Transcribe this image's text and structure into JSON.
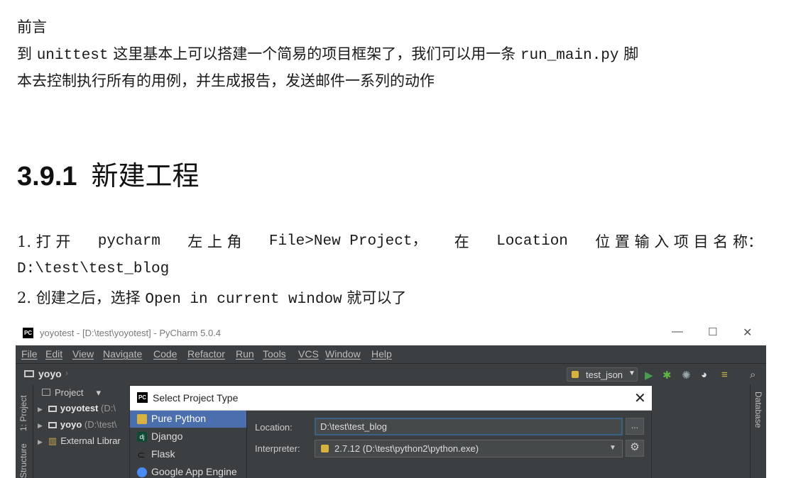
{
  "doc": {
    "preface_title": "前言",
    "preface_line1_a": "到",
    "preface_line1_b": "unittest",
    "preface_line1_c": "这里基本上可以搭建一个简易的项目框架了，我们可以用一条",
    "preface_line1_d": "run_main.py",
    "preface_line1_e": "脚",
    "preface_line2": "本去控制执行所有的用例，并生成报告，发送邮件一系列的动作",
    "section_number": "3.9.1",
    "section_title": "新建工程",
    "step1_a": "1. 打 开",
    "step1_b": "pycharm",
    "step1_c": "左 上 角",
    "step1_d": "File>New Project，",
    "step1_e": "在",
    "step1_f": "Location",
    "step1_g": "位 置 输 入 项 目 名 称：",
    "step1_path": "D:\\test\\test_blog",
    "step2_a": "2. 创建之后，选择",
    "step2_b": "Open in current window",
    "step2_c": "就可以了"
  },
  "ide": {
    "window_title": "yoyotest - [D:\\test\\yoyotest] - PyCharm 5.0.4",
    "app_icon_text": "PC",
    "menu": [
      "File",
      "Edit",
      "View",
      "Navigate",
      "Code",
      "Refactor",
      "Run",
      "Tools",
      "VCS",
      "Window",
      "Help"
    ],
    "breadcrumb_project": "yoyo",
    "run_config": "test_json",
    "side_tool_project": "1: Project",
    "side_tool_structure": "Structure",
    "right_tool_database": "Database",
    "project_panel_header": "Project",
    "tree": [
      {
        "name": "yoyotest",
        "path": "(D:\\"
      },
      {
        "name": "yoyo",
        "path": "(D:\\test\\"
      },
      {
        "name": "External Librar",
        "path": ""
      }
    ]
  },
  "dialog": {
    "title": "Select Project Type",
    "project_types": [
      "Pure Python",
      "Django",
      "Flask",
      "Google App Engine"
    ],
    "location_label": "Location:",
    "location_value": "D:\\test\\test_blog",
    "interpreter_label": "Interpreter:",
    "interpreter_value": "2.7.12 (D:\\test\\python2\\python.exe)",
    "browse_label": "...",
    "close_label": "✕"
  },
  "colors": {
    "ide_bg": "#3c3f41",
    "selection": "#4b6eaf",
    "run_green": "#499c54"
  }
}
